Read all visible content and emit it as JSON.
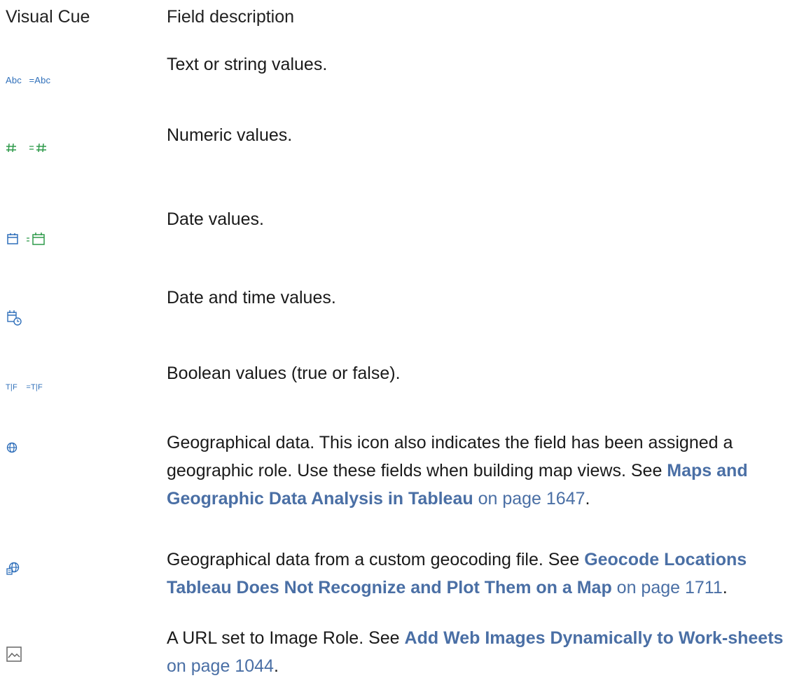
{
  "header": {
    "visual_cue": "Visual Cue",
    "field_description": "Field description"
  },
  "colors": {
    "blue_icon": "#2f6fba",
    "green_icon": "#2e9a4a",
    "grey_icon": "#666666",
    "link": "#4a6fa5"
  },
  "rows": [
    {
      "icon_names": [
        "string-icon",
        "calculated-string-icon"
      ],
      "icon_text_1": "Abc",
      "icon_text_2": "=Abc",
      "description": "Text or string values."
    },
    {
      "icon_names": [
        "number-icon",
        "calculated-number-icon"
      ],
      "description": "Numeric values."
    },
    {
      "icon_names": [
        "date-icon",
        "calculated-date-icon"
      ],
      "description": "Date values."
    },
    {
      "icon_names": [
        "date-time-icon"
      ],
      "description": "Date and time values."
    },
    {
      "icon_names": [
        "boolean-icon",
        "calculated-boolean-icon"
      ],
      "icon_text_1": "T|F",
      "icon_text_2": "=T|F",
      "description": "Boolean values (true or false)."
    },
    {
      "icon_names": [
        "globe-icon"
      ],
      "description_pre": "Geographical data. This icon also indicates the field has been assigned a geographic role. Use these fields when building map views. See ",
      "link_text": "Maps and Geographic Data Analysis in Tableau",
      "page_ref": "on page 1647",
      "description_post": "."
    },
    {
      "icon_names": [
        "custom-geocoding-globe-icon"
      ],
      "description_pre": "Geographical data from a custom geocoding file. See ",
      "link_text": "Geocode Locations Tableau Does Not Recognize and Plot Them on a Map",
      "page_ref": "on page 1711",
      "description_post": "."
    },
    {
      "icon_names": [
        "image-icon"
      ],
      "description_pre": "A URL set to Image Role. See ",
      "link_text": "Add Web Images Dynamically to Work-sheets",
      "page_ref": "on page 1044",
      "description_post": "."
    }
  ]
}
